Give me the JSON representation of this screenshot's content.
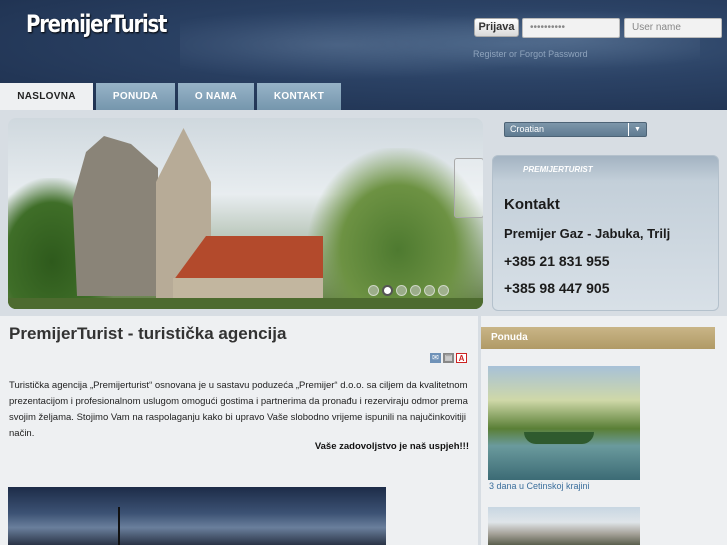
{
  "header": {
    "logo": "PremijerTurist",
    "login_button": "Prijava",
    "password_value": "••••••••••",
    "username_placeholder": "User name",
    "register_link": "Register",
    "separator": "or",
    "forgot_link": "Forgot Password"
  },
  "nav": {
    "tabs": [
      {
        "label": "NASLOVNA",
        "active": true
      },
      {
        "label": "PONUDA",
        "active": false
      },
      {
        "label": "O NAMA",
        "active": false
      },
      {
        "label": "KONTAKT",
        "active": false
      }
    ]
  },
  "slider": {
    "slide_count": 6,
    "active_slide": 1
  },
  "language": {
    "selected": "Croatian",
    "arrow_icon": "chevron-down-icon"
  },
  "contact_box": {
    "brand": "PREMIJERTURIST",
    "title": "Kontakt",
    "company": "Premijer Gaz - Jabuka, Trilj",
    "phone1": "+385 21 831 955",
    "phone2": "+385 98 447 905"
  },
  "main": {
    "title": "PremijerTurist - turistička agencija",
    "intro": "Turistička agencija „Premijerturist“ osnovana je u sastavu poduzeća „Premijer“ d.o.o. sa ciljem da kvalitetnom prezentacijom i profesionalnom uslugom omogući gostima i partnerima da pronađu i rezerviraju odmor prema svojim željama. Stojimo Vam na raspolaganju kako bi upravo Vaše slobodno vrijeme ispunili na najučinkovitiji način.",
    "motto": "Vaše zadovoljstvo je naš uspjeh!!!",
    "tools": {
      "email_icon": "email-icon",
      "print_icon": "print-icon",
      "pdf_icon": "pdf-icon"
    }
  },
  "ponuda": {
    "title": "Ponuda",
    "offers": [
      {
        "label": "3 dana u Cetinskoj krajini"
      }
    ]
  },
  "colors": {
    "header_bg": "#2b4265",
    "tab_bg": "#7596ad",
    "ponuda_header": "#b09a66",
    "link": "#3c6f9c"
  }
}
